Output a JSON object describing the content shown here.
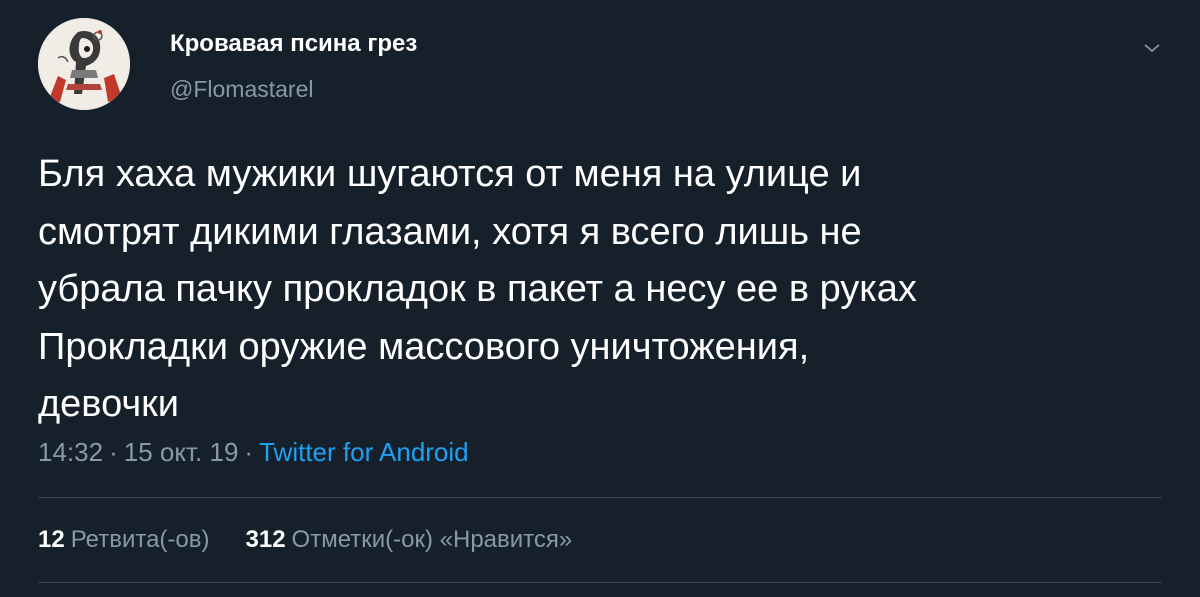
{
  "author": {
    "display_name": "Кровавая псина грез",
    "handle": "@Flomastarel"
  },
  "icons": {
    "avatar": "avatar",
    "menu": "chevron-down-icon"
  },
  "colors": {
    "background": "#15202b",
    "secondary_text": "#8899a6",
    "link": "#1da1f2",
    "divider": "#38444d"
  },
  "tweet": {
    "text": "Бля хаха мужики шугаются от меня на улице и\nсмотрят дикими глазами, хотя я всего лишь не\nубрала пачку прокладок в пакет а несу ее в руках\nПрокладки оружие массового уничтожения,\nдевочки",
    "time": "14:32",
    "separator": "·",
    "date": "15 окт. 19",
    "source": "Twitter for Android"
  },
  "stats": {
    "retweets_count": "12",
    "retweets_label": "Ретвита(-ов)",
    "likes_count": "312",
    "likes_label": "Отметки(-ок) «Нравится»"
  }
}
